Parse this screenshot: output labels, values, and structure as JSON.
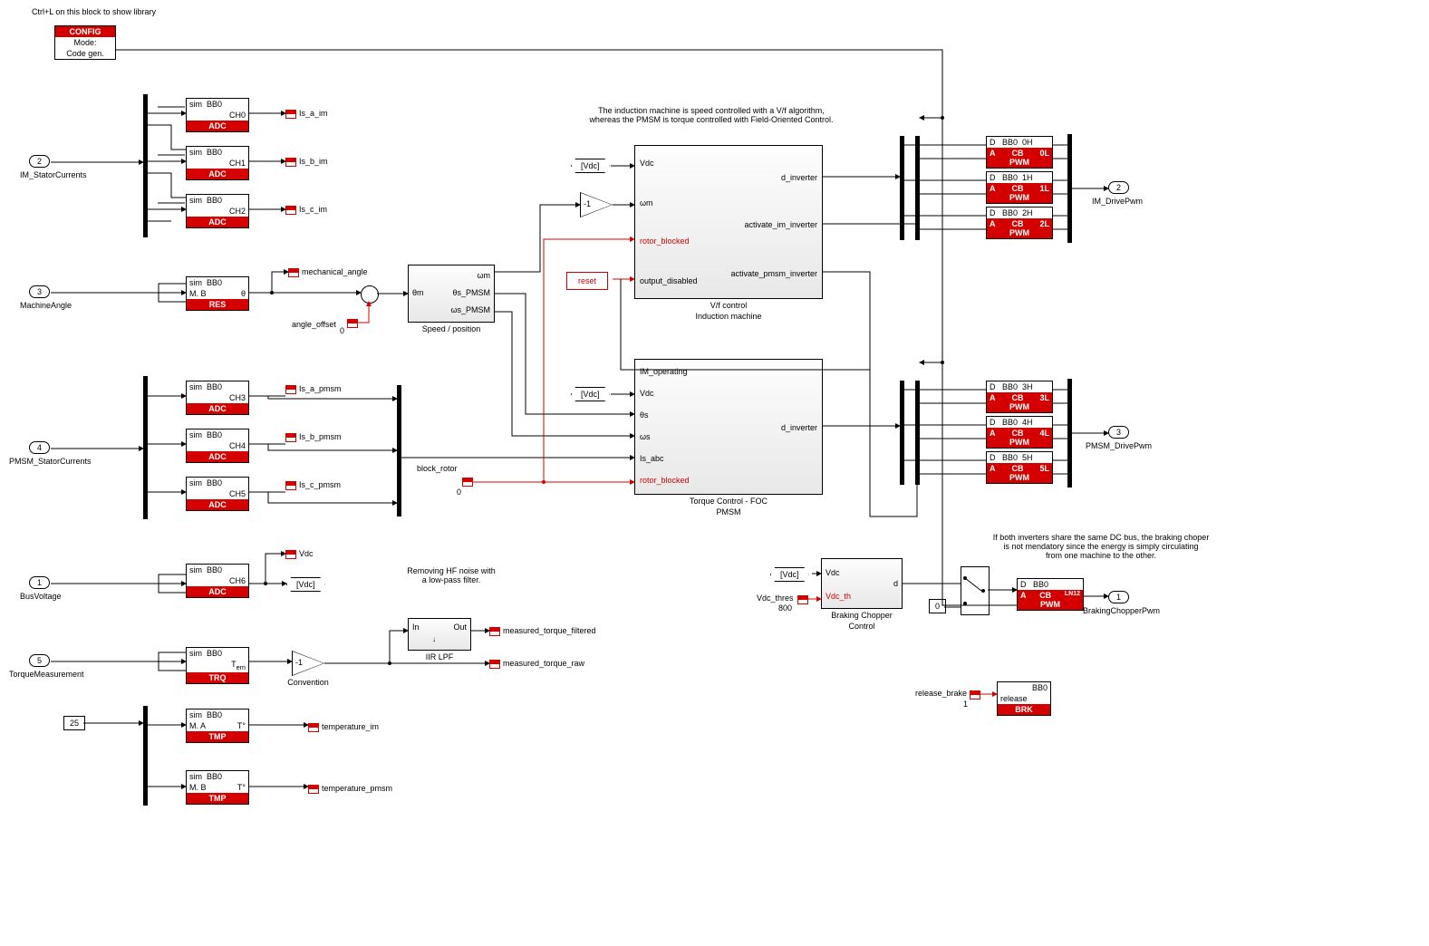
{
  "header_hint": "Ctrl+L on this block to show library",
  "config": {
    "tag": "CONFIG",
    "line1": "Mode:",
    "line2": "Code gen."
  },
  "inports": {
    "p1": {
      "num": "1",
      "label": "BusVoltage"
    },
    "p2": {
      "num": "2",
      "label": "IM_StatorCurrents"
    },
    "p3": {
      "num": "3",
      "label": "MachineAngle"
    },
    "p4": {
      "num": "4",
      "label": "PMSM_StatorCurrents"
    },
    "p5": {
      "num": "5",
      "label": "TorqueMeasurement"
    }
  },
  "outports": {
    "o1": {
      "num": "1",
      "label": "BrakingChopperPwm"
    },
    "o2": {
      "num": "2",
      "label": "IM_DrivePwm"
    },
    "o3": {
      "num": "3",
      "label": "PMSM_DrivePwm"
    }
  },
  "adc": {
    "sim": "sim",
    "bb": "BB0",
    "type": "ADC",
    "ch0": "CH0",
    "ch1": "CH1",
    "ch2": "CH2",
    "ch3": "CH3",
    "ch4": "CH4",
    "ch5": "CH5",
    "ch6": "CH6"
  },
  "res": {
    "sim": "sim",
    "bb": "BB0",
    "mb": "M. B",
    "theta": "θ",
    "type": "RES"
  },
  "trq": {
    "sim": "sim",
    "bb": "BB0",
    "tem": "T",
    "sub": "em",
    "type": "TRQ"
  },
  "tmpA": {
    "sim": "sim",
    "bb": "BB0",
    "m": "M. A",
    "t": "T°",
    "type": "TMP"
  },
  "tmpB": {
    "sim": "sim",
    "bb": "BB0",
    "m": "M. B",
    "t": "T°",
    "type": "TMP"
  },
  "pwm": {
    "d": "D",
    "a": "A",
    "bb": "BB0",
    "cb": "CB",
    "type": "PWM",
    "p0h": "0H",
    "p0l": "0L",
    "p1h": "1H",
    "p1l": "1L",
    "p2h": "2H",
    "p2l": "2L",
    "p3h": "3H",
    "p3l": "3L",
    "p4h": "4H",
    "p4l": "4L",
    "p5h": "5H",
    "p5l": "5L",
    "lane12": "LN12"
  },
  "brk": {
    "bb": "BB0",
    "rel": "release",
    "type": "BRK"
  },
  "gotos": {
    "is_a_im": "Is_a_im",
    "is_b_im": "Is_b_im",
    "is_c_im": "Is_c_im",
    "is_a_pmsm": "Is_a_pmsm",
    "is_b_pmsm": "Is_b_pmsm",
    "is_c_pmsm": "Is_c_pmsm",
    "mech_angle": "mechanical_angle",
    "angle_offset": "angle_offset",
    "angle_offset_val": "0",
    "vdc": "Vdc",
    "vdc_tag": "[Vdc]",
    "meas_tf": "measured_torque_filtered",
    "meas_tr": "measured_torque_raw",
    "temp_im": "temperature_im",
    "temp_pmsm": "temperature_pmsm",
    "block_rotor": "block_rotor",
    "block_rotor_val": "0",
    "vdc_thres": "Vdc_thres",
    "vdc_thres_val": "800",
    "release_brake": "release_brake",
    "release_brake_val": "1",
    "zero": "0"
  },
  "gains": {
    "neg1": "-1",
    "conv": "Convention"
  },
  "reset": "reset",
  "subsys": {
    "speed": {
      "title": "Speed / position",
      "in": "θm",
      "out1": "ωm",
      "out2": "θs_PMSM",
      "out3": "ωs_PMSM"
    },
    "vf": {
      "title1": "V/f control",
      "title2": "Induction machine",
      "in1": "Vdc",
      "in2": "ωm",
      "in3": "rotor_blocked",
      "in4": "output_disabled",
      "out1": "d_inverter",
      "out2": "activate_im_inverter",
      "out3": "activate_pmsm_inverter"
    },
    "foc": {
      "title1": "Torque Control - FOC",
      "title2": "PMSM",
      "in1": "IM_operating",
      "in2": "Vdc",
      "in3": "θs",
      "in4": "ωs",
      "in5": "Is_abc",
      "in6": "rotor_blocked",
      "out1": "d_inverter"
    },
    "iir": {
      "title": "IIR LPF",
      "in": "In",
      "out": "Out"
    },
    "brake": {
      "title1": "Braking Chopper",
      "title2": "Control",
      "in1": "Vdc",
      "in2": "Vdc_th",
      "out": "d"
    }
  },
  "notes": {
    "top": "The induction machine is speed controlled with a V/f algorithm,\nwhereas the PMSM is torque controlled with Field-Oriented Control.",
    "lpf": "Removing HF noise with\na low-pass filter.",
    "brake": "If both inverters share the same DC bus, the braking choper\nis not mendatory since the energy is simply circulating\nfrom one machine to the other."
  },
  "const25": "25"
}
